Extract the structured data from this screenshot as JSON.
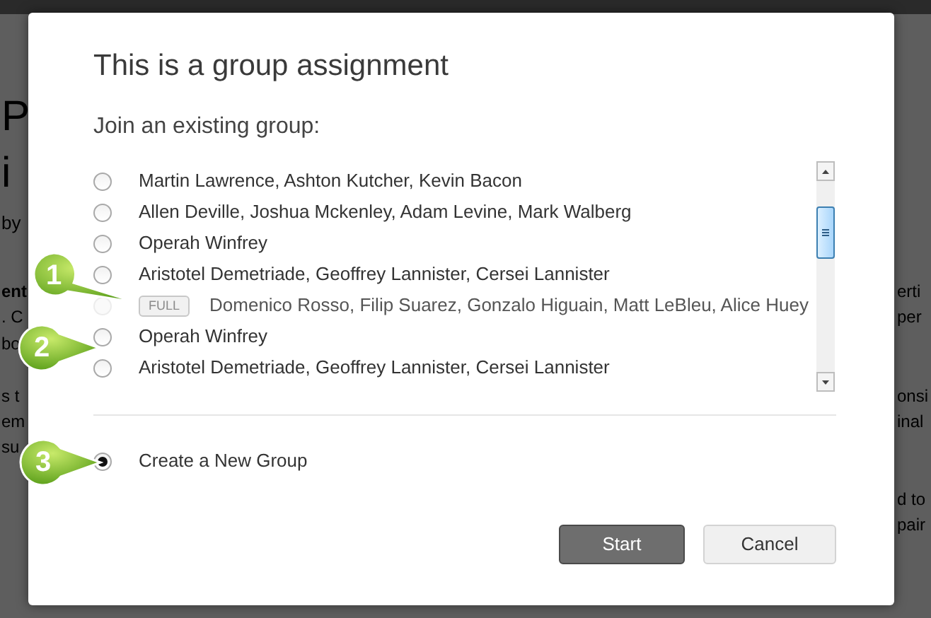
{
  "background_page": {
    "left_fragments": [
      "P",
      "i",
      "by",
      "ent",
      ". C",
      "bo",
      "s t",
      "em",
      "su"
    ],
    "right_fragments": [
      "erti",
      "per",
      "onsi",
      "inal",
      "d to",
      "pair"
    ]
  },
  "dialog": {
    "title": "This is a group assignment",
    "section_label": "Join an existing group:",
    "groups": [
      {
        "members": "Martin Lawrence, Ashton Kutcher, Kevin Bacon",
        "selected": false,
        "disabled": false
      },
      {
        "members": "Allen Deville, Joshua Mckenley, Adam Levine, Mark Walberg",
        "selected": false,
        "disabled": false
      },
      {
        "members": "Operah Winfrey",
        "selected": false,
        "disabled": false
      },
      {
        "members": "Aristotel Demetriade, Geoffrey Lannister, Cersei Lannister",
        "selected": false,
        "disabled": false
      },
      {
        "members": "Domenico Rosso, Filip Suarez, Gonzalo Higuain, Matt LeBleu, Alice Huey",
        "selected": false,
        "disabled": true,
        "badge": "FULL"
      },
      {
        "members": "Operah Winfrey",
        "selected": false,
        "disabled": false
      },
      {
        "members": "Aristotel Demetriade, Geoffrey Lannister, Cersei Lannister",
        "selected": false,
        "disabled": false
      }
    ],
    "new_group": {
      "label": "Create a New Group",
      "selected": true
    },
    "buttons": [
      {
        "label": "Start",
        "kind": "primary"
      },
      {
        "label": "Cancel",
        "kind": "secondary"
      }
    ]
  },
  "callouts": [
    {
      "number": "1"
    },
    {
      "number": "2"
    },
    {
      "number": "3"
    }
  ]
}
